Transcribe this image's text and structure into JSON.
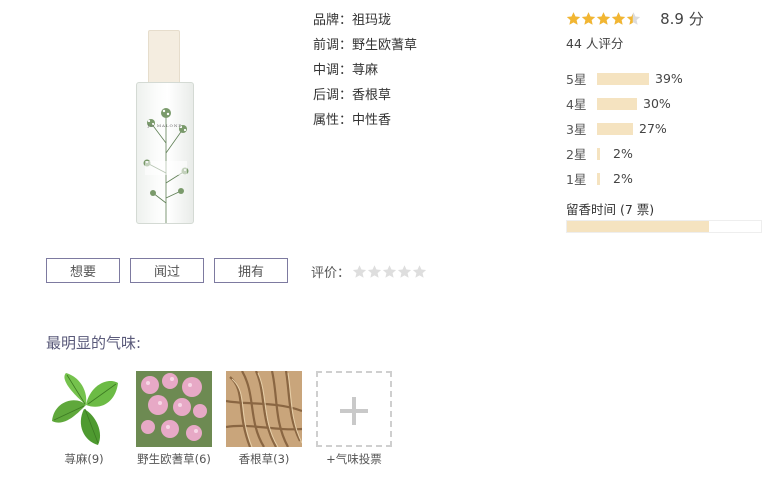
{
  "product": {
    "image_label": "JO MALONE",
    "brand": "品牌：祖玛珑",
    "top_note": "前调：野生欧蓍草",
    "middle_note": "中调：荨麻",
    "base_note": "后调：香根草",
    "attribute": "属性：中性香"
  },
  "rating": {
    "stars": 4.45,
    "score": "8.9 分",
    "votes": "44 人评分",
    "distribution": [
      {
        "label": "5星",
        "percent": 39,
        "text": "39%"
      },
      {
        "label": "4星",
        "percent": 30,
        "text": "30%"
      },
      {
        "label": "3星",
        "percent": 27,
        "text": "27%"
      },
      {
        "label": "2星",
        "percent": 2,
        "text": "2%"
      },
      {
        "label": "1星",
        "percent": 2,
        "text": "2%"
      }
    ],
    "longevity_label": "留香时间 (7 票)",
    "longevity_fraction": 0.73,
    "bar_color": "#f5e3c0",
    "star_color": "#f2b632"
  },
  "actions": {
    "want": "想要",
    "smelled": "闻过",
    "own": "拥有",
    "rate_label": "评价："
  },
  "notes": {
    "title": "最明显的气味:",
    "items": [
      {
        "label": "荨麻(9)",
        "icon": "nettle-leaf"
      },
      {
        "label": "野生欧蓍草(6)",
        "icon": "yarrow-flower"
      },
      {
        "label": "香根草(3)",
        "icon": "vetiver-root"
      }
    ],
    "vote_label": "+气味投票"
  }
}
